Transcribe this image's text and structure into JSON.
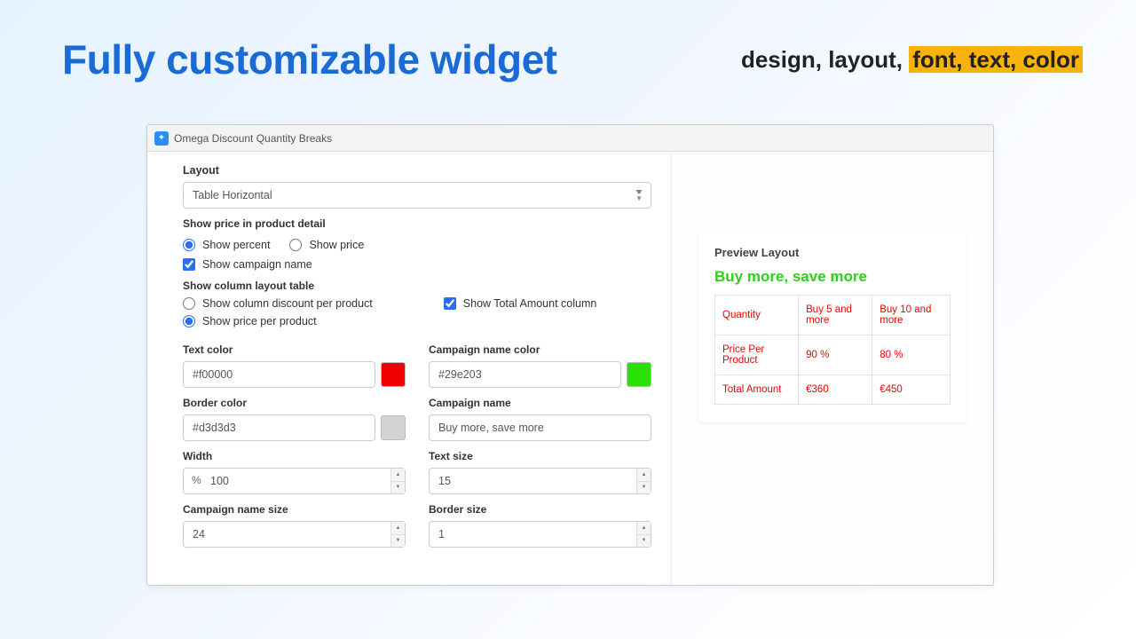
{
  "hero": {
    "headline": "Fully customizable widget",
    "tagline_plain": "design, layout, ",
    "tagline_highlight": "font, text, color"
  },
  "app": {
    "title": "Omega Discount Quantity Breaks"
  },
  "form": {
    "layout_label": "Layout",
    "layout_value": "Table Horizontal",
    "show_price_label": "Show price in product detail",
    "show_percent": "Show percent",
    "show_price": "Show price",
    "show_campaign_name": "Show campaign name",
    "show_column_label": "Show column layout table",
    "show_column_discount": "Show column discount per product",
    "show_total_amount": "Show Total Amount column",
    "show_price_per_product": "Show price per product",
    "text_color_label": "Text color",
    "text_color_value": "#f00000",
    "campaign_color_label": "Campaign name color",
    "campaign_color_value": "#29e203",
    "border_color_label": "Border color",
    "border_color_value": "#d3d3d3",
    "campaign_name_label": "Campaign name",
    "campaign_name_value": "Buy more, save more",
    "width_label": "Width",
    "width_prefix": "%",
    "width_value": "100",
    "text_size_label": "Text size",
    "text_size_value": "15",
    "campaign_size_label": "Campaign name size",
    "campaign_size_value": "24",
    "border_size_label": "Border size",
    "border_size_value": "1"
  },
  "colors": {
    "text_color": "#f00000",
    "campaign_color": "#29e203",
    "border_color": "#d3d3d3"
  },
  "preview": {
    "title": "Preview Layout",
    "campaign": "Buy more, save more",
    "rows": {
      "r1c1": "Quantity",
      "r1c2": "Buy 5 and more",
      "r1c3": "Buy 10 and more",
      "r2c1": "Price Per Product",
      "r2c2": "90 %",
      "r2c3": "80 %",
      "r3c1": "Total Amount",
      "r3c2": "€360",
      "r3c3": "€450"
    }
  }
}
